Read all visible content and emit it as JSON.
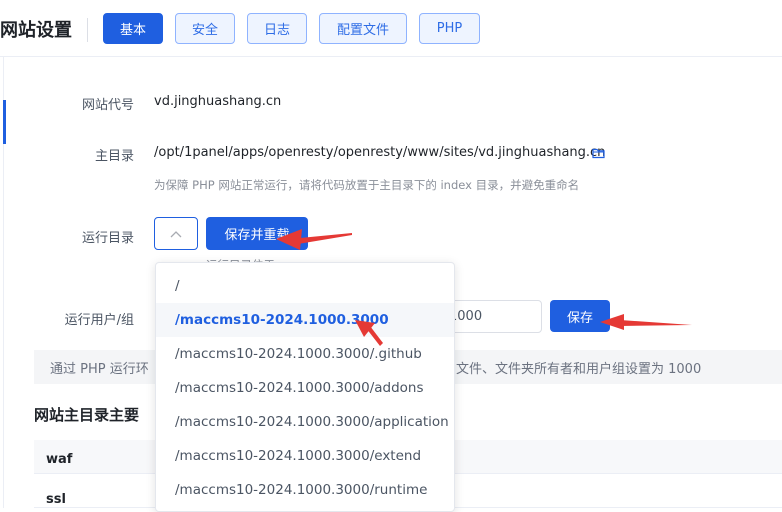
{
  "header": {
    "title": "网站设置",
    "tabs": [
      {
        "label": "基本",
        "active": true
      },
      {
        "label": "安全",
        "active": false
      },
      {
        "label": "日志",
        "active": false
      },
      {
        "label": "配置文件",
        "active": false
      },
      {
        "label": "PHP",
        "active": false
      }
    ]
  },
  "form": {
    "site_code_label": "网站代号",
    "site_code_value": "vd.jinghuashang.cn",
    "root_dir_label": "主目录",
    "root_dir_value": "/opt/1panel/apps/openresty/openresty/www/sites/vd.jinghuashang.cn",
    "root_dir_hint": "为保障 PHP 网站正常运行，请将代码放置于主目录下的 index 目录，并避免重命名",
    "run_dir_label": "运行目录",
    "run_dir_save_reload": "保存并重载",
    "run_dir_hint_fragment": "运行目录位于",
    "run_user_label": "运行用户/组",
    "run_user_value": "1000",
    "run_user_save": "保存",
    "info_text_left": "通过 PHP 运行环",
    "info_text_right": "文件、文件夹所有者和用户组设置为 1000"
  },
  "section": {
    "title_fragment": "网站主目录主要",
    "rows": [
      "waf",
      "ssl"
    ]
  },
  "dropdown": {
    "options": [
      "/",
      "/maccms10-2024.1000.3000",
      "/maccms10-2024.1000.3000/.github",
      "/maccms10-2024.1000.3000/addons",
      "/maccms10-2024.1000.3000/application",
      "/maccms10-2024.1000.3000/extend",
      "/maccms10-2024.1000.3000/runtime"
    ],
    "highlighted_index": 1
  },
  "colors": {
    "primary": "#1f5fe0",
    "annotation_arrow": "#e53935"
  }
}
